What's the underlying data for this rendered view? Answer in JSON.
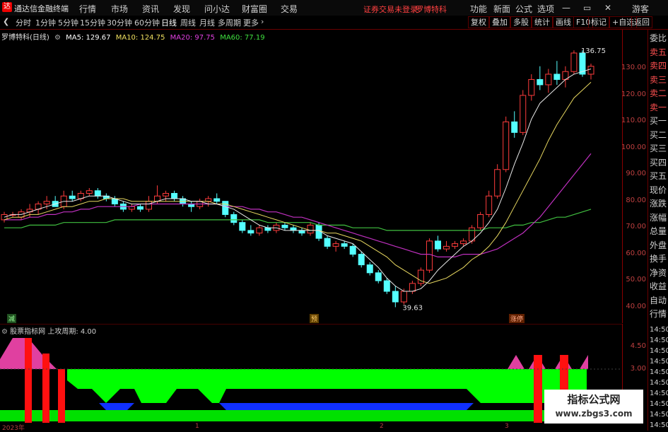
{
  "app": {
    "title": "通达信金融终端",
    "logo_glyph": "达"
  },
  "menu": [
    "行情",
    "市场",
    "资讯",
    "发现",
    "问小达",
    "财富圈",
    "交易"
  ],
  "notice": {
    "warning": "证券交易未登录",
    "stock_name": "罗博特科"
  },
  "menu_right": [
    "功能",
    "新面",
    "公式",
    "选项"
  ],
  "user": "游客",
  "periods": [
    "分时",
    "1分钟",
    "5分钟",
    "15分钟",
    "30分钟",
    "60分钟",
    "日线",
    "周线",
    "月线",
    "多周期",
    "更多"
  ],
  "active_period": "日线",
  "toolbar_right": [
    "复权",
    "叠加",
    "多股",
    "统计",
    "画线",
    "F10",
    "标记",
    "+自选",
    "返回"
  ],
  "stock": {
    "title": "罗博特科(日线)"
  },
  "ma": [
    {
      "label": "MA5: 129.67",
      "color": "#ffffff"
    },
    {
      "label": "MA10: 124.75",
      "color": "#f0e060"
    },
    {
      "label": "MA20: 97.75",
      "color": "#e040e0"
    },
    {
      "label": "MA60: 77.19",
      "color": "#40e040"
    }
  ],
  "price_axis": [
    "130.00",
    "120.00",
    "110.00",
    "100.00",
    "90.00",
    "80.00",
    "70.00",
    "60.00",
    "50.00",
    "40.00"
  ],
  "annotations": {
    "high": "136.75",
    "low": "39.63"
  },
  "markers": {
    "left": "减",
    "mid": "预",
    "right": "涨停"
  },
  "indicator": {
    "title": "股票指标网 上攻周期: 4.00",
    "axis": [
      "4.50",
      "3.00"
    ]
  },
  "right_panel": [
    "委比",
    "卖五",
    "卖四",
    "卖三",
    "卖二",
    "卖一",
    "买一",
    "买二",
    "买三",
    "买四",
    "买五",
    "现价",
    "涨跌",
    "涨幅",
    "总量",
    "外盘",
    "换手",
    "净资",
    "收益",
    "自动",
    "行情"
  ],
  "right_times": [
    "14:50",
    "14:50",
    "14:50",
    "14:50",
    "14:50",
    "14:50",
    "14:50",
    "14:50",
    "14:50",
    "14:50"
  ],
  "x_axis": [
    "2023年",
    "1",
    "2",
    "3"
  ],
  "watermark": {
    "line1": "指标公式网",
    "line2": "www.zbgs3.com"
  },
  "chart_data": {
    "type": "candlestick",
    "ylim": [
      38,
      140
    ],
    "candles": [
      [
        73,
        76,
        72,
        75
      ],
      [
        75,
        76,
        74,
        75
      ],
      [
        74,
        77,
        73,
        76
      ],
      [
        76,
        79,
        74,
        77
      ],
      [
        77,
        80,
        75,
        79
      ],
      [
        79,
        82,
        77,
        80
      ],
      [
        80,
        82,
        78,
        78
      ],
      [
        78,
        84,
        77,
        82
      ],
      [
        82,
        84,
        80,
        81
      ],
      [
        81,
        84,
        80,
        83
      ],
      [
        83,
        85,
        82,
        84
      ],
      [
        84,
        85,
        81,
        82
      ],
      [
        82,
        83,
        80,
        81
      ],
      [
        81,
        82,
        78,
        79
      ],
      [
        79,
        80,
        76,
        77
      ],
      [
        77,
        79,
        76,
        78
      ],
      [
        78,
        79,
        76,
        77
      ],
      [
        77,
        82,
        76,
        80
      ],
      [
        80,
        86,
        79,
        82
      ],
      [
        82,
        84,
        80,
        83
      ],
      [
        83,
        84,
        80,
        81
      ],
      [
        81,
        82,
        78,
        79
      ],
      [
        79,
        80,
        76,
        78
      ],
      [
        78,
        81,
        77,
        80
      ],
      [
        80,
        82,
        78,
        81
      ],
      [
        81,
        83,
        79,
        80
      ],
      [
        80,
        80,
        74,
        75
      ],
      [
        75,
        76,
        71,
        72
      ],
      [
        72,
        73,
        68,
        69
      ],
      [
        69,
        71,
        67,
        68
      ],
      [
        68,
        71,
        67,
        70
      ],
      [
        70,
        71,
        68,
        69
      ],
      [
        69,
        72,
        68,
        71
      ],
      [
        71,
        72,
        69,
        70
      ],
      [
        70,
        71,
        68,
        69
      ],
      [
        69,
        70,
        67,
        68
      ],
      [
        68,
        72,
        67,
        71
      ],
      [
        71,
        72,
        65,
        66
      ],
      [
        66,
        67,
        62,
        63
      ],
      [
        63,
        65,
        61,
        64
      ],
      [
        64,
        65,
        62,
        63
      ],
      [
        63,
        64,
        59,
        60
      ],
      [
        60,
        61,
        55,
        56
      ],
      [
        56,
        57,
        52,
        53
      ],
      [
        53,
        54,
        49,
        50
      ],
      [
        50,
        51,
        45,
        46
      ],
      [
        46,
        48,
        40,
        42
      ],
      [
        42,
        47,
        41,
        46
      ],
      [
        46,
        50,
        45,
        49
      ],
      [
        49,
        55,
        48,
        54
      ],
      [
        54,
        66,
        53,
        65
      ],
      [
        65,
        67,
        61,
        62
      ],
      [
        62,
        65,
        61,
        63
      ],
      [
        63,
        65,
        62,
        64
      ],
      [
        64,
        66,
        63,
        65
      ],
      [
        65,
        71,
        64,
        70
      ],
      [
        70,
        76,
        69,
        75
      ],
      [
        75,
        84,
        74,
        82
      ],
      [
        82,
        94,
        81,
        92
      ],
      [
        92,
        112,
        91,
        110
      ],
      [
        110,
        114,
        104,
        106
      ],
      [
        106,
        122,
        105,
        120
      ],
      [
        120,
        128,
        118,
        126
      ],
      [
        126,
        131,
        122,
        124
      ],
      [
        124,
        130,
        121,
        128
      ],
      [
        128,
        133,
        124,
        126
      ],
      [
        126,
        131,
        123,
        129
      ],
      [
        129,
        137,
        128,
        136
      ],
      [
        136,
        137,
        127,
        128
      ],
      [
        128,
        132,
        126,
        131
      ]
    ],
    "ma5": [
      74,
      75,
      75,
      76,
      77,
      78,
      79,
      80,
      80,
      81,
      82,
      82,
      82,
      81,
      80,
      79,
      79,
      79,
      80,
      81,
      81,
      81,
      80,
      80,
      79,
      79,
      78,
      77,
      75,
      73,
      71,
      70,
      70,
      69,
      69,
      69,
      69,
      69,
      67,
      66,
      65,
      64,
      61,
      58,
      55,
      51,
      48,
      46,
      46,
      47,
      50,
      54,
      57,
      60,
      63,
      65,
      68,
      72,
      77,
      85,
      94,
      102,
      111,
      117,
      120,
      123,
      126,
      128,
      129,
      130
    ],
    "ma10": [
      73,
      74,
      74,
      75,
      75,
      76,
      77,
      78,
      78,
      79,
      80,
      80,
      81,
      81,
      81,
      80,
      80,
      80,
      80,
      80,
      80,
      80,
      80,
      80,
      80,
      79,
      79,
      78,
      77,
      76,
      75,
      74,
      73,
      72,
      71,
      70,
      69,
      69,
      68,
      68,
      67,
      66,
      65,
      63,
      61,
      59,
      56,
      54,
      52,
      50,
      49,
      50,
      51,
      53,
      55,
      58,
      60,
      63,
      67,
      72,
      78,
      84,
      90,
      96,
      103,
      109,
      114,
      119,
      122,
      125
    ],
    "ma20": [
      73,
      73,
      73,
      74,
      74,
      75,
      75,
      76,
      76,
      77,
      77,
      78,
      78,
      78,
      78,
      78,
      79,
      79,
      79,
      79,
      79,
      79,
      79,
      79,
      79,
      79,
      78,
      78,
      78,
      77,
      77,
      76,
      76,
      75,
      74,
      74,
      73,
      72,
      71,
      70,
      69,
      68,
      67,
      66,
      65,
      64,
      63,
      62,
      61,
      60,
      60,
      59,
      59,
      59,
      60,
      60,
      60,
      61,
      62,
      64,
      66,
      68,
      71,
      74,
      78,
      82,
      86,
      90,
      94,
      98
    ],
    "ma60": [
      70,
      70,
      70,
      71,
      71,
      71,
      71,
      72,
      72,
      72,
      72,
      72,
      72,
      73,
      73,
      73,
      73,
      73,
      73,
      73,
      73,
      73,
      73,
      73,
      73,
      73,
      73,
      73,
      73,
      73,
      73,
      72,
      72,
      72,
      72,
      72,
      72,
      71,
      71,
      71,
      71,
      70,
      70,
      70,
      70,
      69,
      69,
      69,
      69,
      69,
      69,
      69,
      69,
      69,
      69,
      69,
      69,
      70,
      70,
      70,
      71,
      71,
      72,
      72,
      73,
      74,
      74,
      75,
      76,
      77
    ]
  }
}
